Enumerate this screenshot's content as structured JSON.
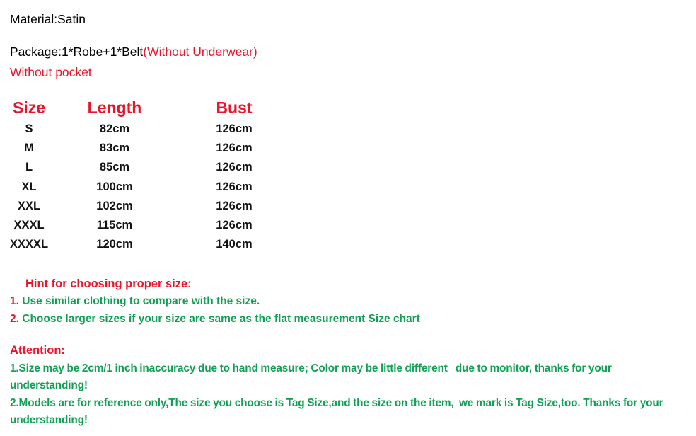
{
  "colors": {
    "red": "#e8152a",
    "green": "#12a055",
    "black": "#131313",
    "background": "#ffffff"
  },
  "intro": {
    "material_line": "Material:Satin",
    "package_label": "Package:1*Robe+1*Belt",
    "package_note": "(Without Underwear)",
    "pocket_note": "Without pocket"
  },
  "size_chart": {
    "type": "table",
    "headers": [
      "Size",
      "Length",
      "Bust"
    ],
    "rows": [
      [
        "S",
        "82cm",
        "126cm"
      ],
      [
        "M",
        "83cm",
        "126cm"
      ],
      [
        "L",
        "85cm",
        "126cm"
      ],
      [
        "XL",
        "100cm",
        "126cm"
      ],
      [
        "XXL",
        "102cm",
        "126cm"
      ],
      [
        "XXXL",
        "115cm",
        "126cm"
      ],
      [
        "XXXXL",
        "120cm",
        "140cm"
      ]
    ]
  },
  "hint": {
    "title": "Hint for choosing proper size:",
    "items": [
      {
        "num": "1.",
        "text": " Use similar clothing to compare with the size."
      },
      {
        "num": "2.",
        "text": " Choose larger sizes if your size are same as the flat measurement Size chart"
      }
    ]
  },
  "attention": {
    "title": "Attention:",
    "items": [
      "1.Size may be 2cm/1 inch inaccuracy due to hand measure; Color may be little different   due to monitor, thanks for your understanding!",
      "2.Models are for reference only,The size you choose is Tag Size,and the size on the item,  we mark is Tag Size,too. Thanks for your understanding!"
    ]
  }
}
